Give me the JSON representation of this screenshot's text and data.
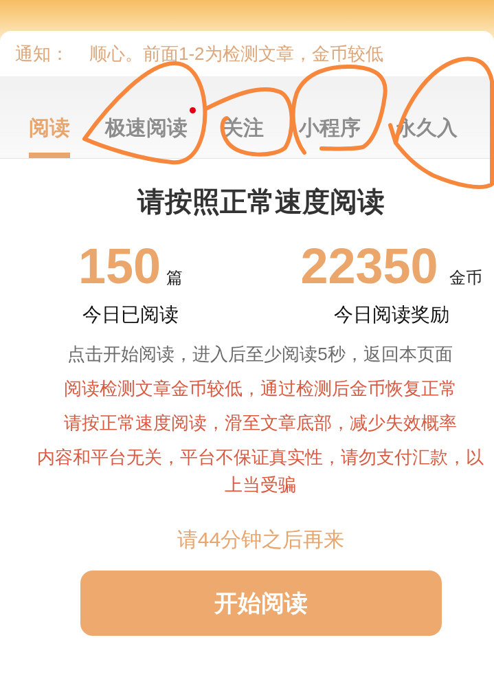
{
  "notice": {
    "label": "通知：",
    "message": "顺心。前面1-2为检测文章，金币较低"
  },
  "tabs": [
    {
      "label": "阅读",
      "selected": true,
      "unread_dot": false
    },
    {
      "label": "极速阅读",
      "selected": false,
      "unread_dot": true
    },
    {
      "label": "关注",
      "selected": false,
      "unread_dot": false
    },
    {
      "label": "小程序",
      "selected": false,
      "unread_dot": false
    },
    {
      "label": "永久入",
      "selected": false,
      "unread_dot": false
    }
  ],
  "title": "请按照正常速度阅读",
  "stats": [
    {
      "value": "150",
      "unit": "篇",
      "label": "今日已阅读"
    },
    {
      "value": "22350",
      "unit": "金币",
      "label": "今日阅读奖励"
    }
  ],
  "instructions": [
    {
      "kind": "normal",
      "lines": [
        "点击开始阅读，进入后至少阅读5秒，返回本页面"
      ]
    },
    {
      "kind": "warning",
      "lines": [
        "阅读检测文章金币较低，通过检测后金币恢复正常"
      ]
    },
    {
      "kind": "warning",
      "lines": [
        "请按正常速度阅读，滑至文章底部，减少失效概率"
      ]
    },
    {
      "kind": "warning",
      "lines": [
        "内容和平台无关，平台不保证真实性，请勿支付汇款，以",
        "上当受骗"
      ]
    }
  ],
  "cooldown": "请44分钟之后再来",
  "button": {
    "label": "开始阅读"
  }
}
